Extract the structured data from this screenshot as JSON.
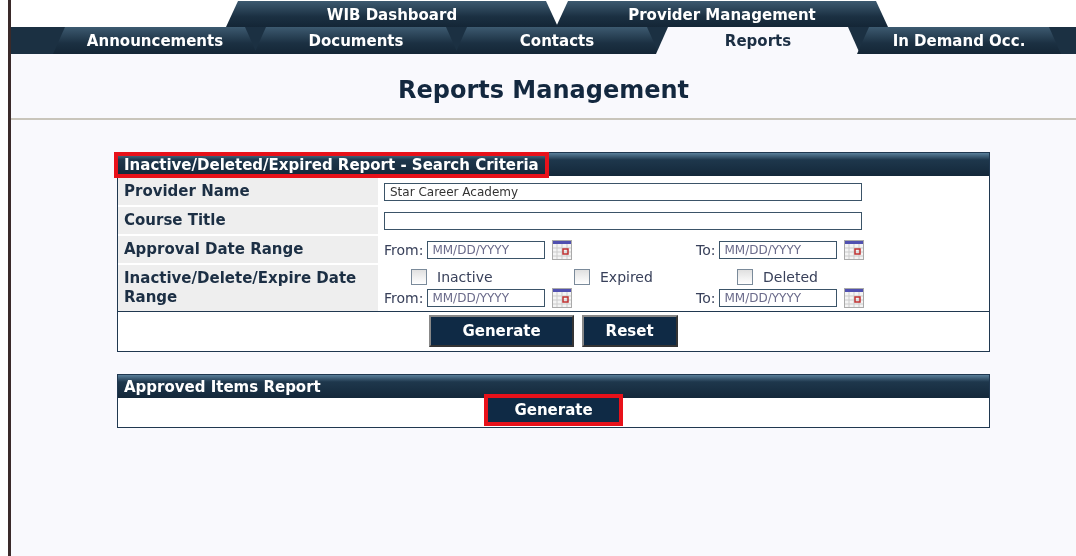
{
  "top_tabs": [
    {
      "label": "WIB Dashboard",
      "selected": false
    },
    {
      "label": "Provider Management",
      "selected": false
    }
  ],
  "tabs": [
    {
      "label": "Announcements",
      "selected": false
    },
    {
      "label": "Documents",
      "selected": false
    },
    {
      "label": "Contacts",
      "selected": false
    },
    {
      "label": "Reports",
      "selected": true
    },
    {
      "label": "In Demand Occ.",
      "selected": false
    }
  ],
  "page_title": "Reports Management",
  "search_panel": {
    "title": "Inactive/Deleted/Expired Report - Search Criteria",
    "highlighted": true,
    "rows": [
      {
        "kind": "text",
        "label": "Provider Name",
        "value": "Star Career Academy"
      },
      {
        "kind": "text",
        "label": "Course Title"
      },
      {
        "kind": "date_range",
        "label": "Approval Date Range",
        "from_label": "From:",
        "from_placeholder": "MM/DD/YYYY",
        "to_label": "To:",
        "to_placeholder": "MM/DD/YYYY"
      },
      {
        "kind": "status_date_range",
        "label": "Inactive/Delete/Expire Date Range",
        "checkboxes": [
          {
            "label": "Inactive",
            "checked": false
          },
          {
            "label": "Expired",
            "checked": false
          },
          {
            "label": "Deleted",
            "checked": false
          }
        ],
        "from_label": "From:",
        "from_placeholder": "MM/DD/YYYY",
        "to_label": "To:",
        "to_placeholder": "MM/DD/YYYY"
      }
    ],
    "buttons": [
      {
        "label": "Generate",
        "highlighted": false
      },
      {
        "label": "Reset",
        "highlighted": false
      }
    ]
  },
  "approved_panel": {
    "title": "Approved Items Report",
    "highlighted": false,
    "buttons": [
      {
        "label": "Generate",
        "highlighted": true
      }
    ]
  }
}
